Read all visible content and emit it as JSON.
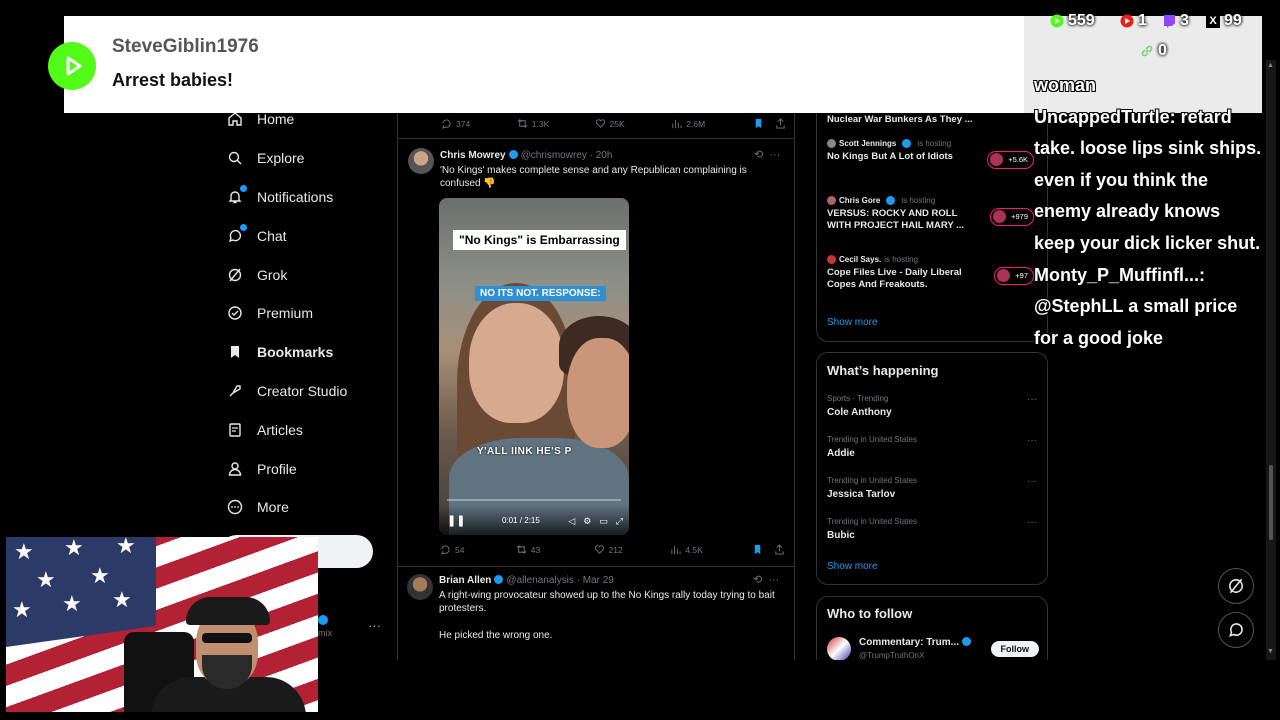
{
  "nav": {
    "items": [
      {
        "label": "Home",
        "icon": "home-icon"
      },
      {
        "label": "Explore",
        "icon": "search-icon"
      },
      {
        "label": "Notifications",
        "icon": "bell-icon"
      },
      {
        "label": "Chat",
        "icon": "chat-icon"
      },
      {
        "label": "Grok",
        "icon": "grok-icon"
      },
      {
        "label": "Premium",
        "icon": "premium-icon"
      },
      {
        "label": "Bookmarks",
        "icon": "bookmark-icon"
      },
      {
        "label": "Creator Studio",
        "icon": "rocket-icon"
      },
      {
        "label": "Articles",
        "icon": "article-icon"
      },
      {
        "label": "Profile",
        "icon": "profile-icon"
      },
      {
        "label": "More",
        "icon": "more-circle-icon"
      }
    ],
    "account_handle": "mix",
    "account_more": "···"
  },
  "timeline": {
    "prev_tweet_actions": {
      "replies": "374",
      "retweets": "1.3K",
      "likes": "25K",
      "views": "2.6M"
    },
    "tweet1": {
      "name": "Chris Mowrey",
      "handle": "@chrismowrey · 20h",
      "text": "'No Kings' makes complete sense and any Republican complaining is confused 👎",
      "video": {
        "caption_top": "\"No Kings\" is Embarrassing",
        "caption_blue": "NO ITS NOT. RESPONSE:",
        "subtitle": "Y'ALL   IINK HE'S P",
        "time": "0:01 / 2:15"
      },
      "actions": {
        "replies": "54",
        "retweets": "43",
        "likes": "212",
        "views": "4.5K"
      }
    },
    "tweet2": {
      "name": "Brian Allen",
      "handle": "@allenanalysis · Mar 29",
      "text": "A right-wing provocateur showed up to the No Kings rally today trying to bait protesters.",
      "text2": "He picked the wrong one."
    }
  },
  "spaces": {
    "top_title": "Nuclear War Bunkers As They ...",
    "items": [
      {
        "host": "Scott Jennings",
        "hosting": "is hosting",
        "title": "No Kings But A Lot of Idiots",
        "count": "+5.6K"
      },
      {
        "host": "Chris Gore",
        "hosting": "is hosting",
        "title": "VERSUS: ROCKY AND ROLL WITH PROJECT HAIL MARY ...",
        "count": "+979"
      },
      {
        "host": "Cecil Says.",
        "hosting": "is hosting",
        "title": "Cope Files Live - Daily Liberal Copes And Freakouts.",
        "count": "+97"
      }
    ],
    "show_more": "Show more"
  },
  "whats_happening": {
    "title": "What’s happening",
    "trends": [
      {
        "meta": "Sports · Trending",
        "title": "Cole Anthony"
      },
      {
        "meta": "Trending in United States",
        "title": "Addie"
      },
      {
        "meta": "Trending in United States",
        "title": "Jessica Tarlov"
      },
      {
        "meta": "Trending in United States",
        "title": "Bubic"
      }
    ],
    "show_more": "Show more"
  },
  "who_to_follow": {
    "title": "Who to follow",
    "name": "Commentary: Trum...",
    "handle": "@TrumpTruthOnX",
    "follow_label": "Follow"
  },
  "alert": {
    "username": "SteveGiblin1976",
    "message": "Arrest babies!"
  },
  "stream_stats": {
    "kick_viewers": "559",
    "youtube_viewers": "1",
    "twitch_viewers": "3",
    "x_viewers": "99",
    "link_count": "0"
  },
  "chat": {
    "lines": [
      "woman",
      "UncappedTurtle: retard",
      "take. loose lips sink ships.",
      "even if you think the",
      "enemy already knows",
      "keep your dick licker shut.",
      "Monty_P_Muffinfl...:",
      "@StephLL a small price",
      "for a good joke"
    ]
  },
  "colors": {
    "accent": "#1d9bf0",
    "kick_green": "#53fc18",
    "space_pink": "#f91880"
  }
}
